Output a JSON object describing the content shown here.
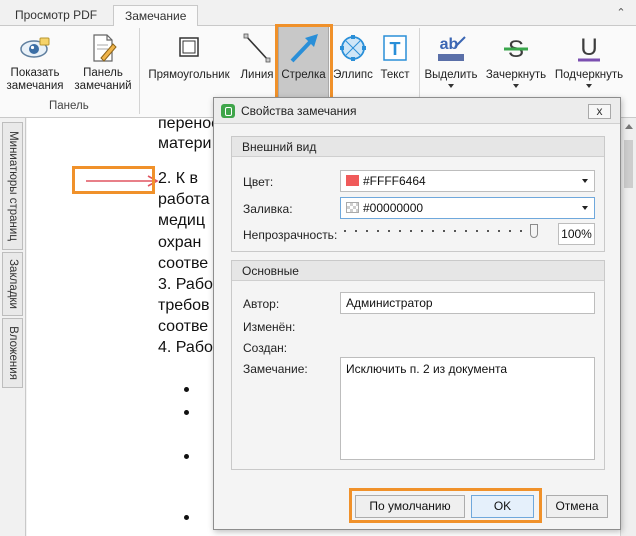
{
  "tabs": [
    {
      "label": "Просмотр PDF",
      "active": false
    },
    {
      "label": "Замечание",
      "active": true
    }
  ],
  "ribbon": {
    "panel_group_label": "Панель",
    "show_comments": "Показать замечания",
    "comments_panel": "Панель замечаний",
    "rectangle": "Прямоугольник",
    "line": "Линия",
    "arrow": "Стрелка",
    "ellipse": "Эллипс",
    "text": "Текст",
    "highlight": "Выделить",
    "strikeout": "Зачеркнуть",
    "underline": "Подчеркнуть",
    "highlight_icon_text": "ab",
    "strikeout_icon_text": "S",
    "underline_icon_text": "U",
    "text_icon_text": "T"
  },
  "side_tabs": [
    "Миниатюры страниц",
    "Закладки",
    "Вложения"
  ],
  "document": {
    "lines": [
      "перенос",
      "матери",
      "2. К     в",
      "работа",
      "медиц",
      "охран",
      "соотве",
      "3. Рабо",
      "требов",
      "соотве",
      "4. Рабо"
    ]
  },
  "colors": {
    "accent_highlight": "#f0912a",
    "arrow_annotation": "#e05560",
    "color_swatch": "#f05a5a"
  },
  "dialog": {
    "title": "Свойства замечания",
    "close_label": "x",
    "appearance_section": "Внешний вид",
    "color_label": "Цвет:",
    "color_value": "#FFFF6464",
    "fill_label": "Заливка:",
    "fill_value": "#00000000",
    "opacity_label": "Непрозрачность:",
    "opacity_value": "100%",
    "opacity_level": 1.0,
    "basic_section": "Основные",
    "author_label": "Автор:",
    "author_value": "Администратор",
    "modified_label": "Изменён:",
    "created_label": "Создан:",
    "comment_label": "Замечание:",
    "comment_value": "Исключить п. 2 из документа",
    "default_button": "По умолчанию",
    "ok_button": "OK",
    "cancel_button": "Отмена"
  }
}
